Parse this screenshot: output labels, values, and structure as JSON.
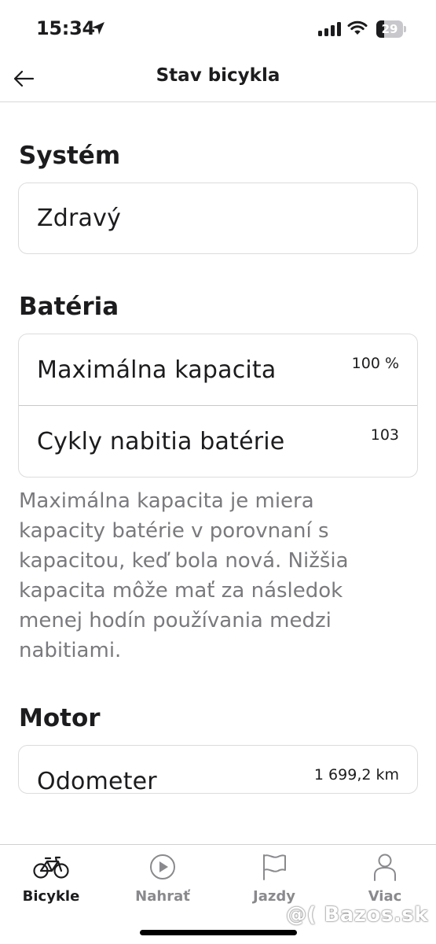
{
  "status_bar": {
    "time": "15:34",
    "battery_level": "29",
    "battery_fraction": 0.29
  },
  "header": {
    "title": "Stav bicykla"
  },
  "system": {
    "title": "Systém",
    "status": "Zdravý"
  },
  "battery": {
    "title": "Batéria",
    "rows": [
      {
        "label": "Maximálna kapacita",
        "value": "100 %"
      },
      {
        "label": "Cykly nabitia batérie",
        "value": "103"
      }
    ],
    "note": "Maximálna kapacita je miera kapacity batérie v porovnaní s kapacitou, keď bola nová. Nižšia kapacita môže mať za následok menej hodín používania medzi nabitiami."
  },
  "motor": {
    "title": "Motor",
    "rows": [
      {
        "label": "Odometer",
        "value": "1 699,2 km"
      }
    ]
  },
  "tab_bar": {
    "tabs": [
      {
        "label": "Bicykle",
        "icon": "bicycle-icon",
        "active": true
      },
      {
        "label": "Nahrať",
        "icon": "play-icon",
        "active": false
      },
      {
        "label": "Jazdy",
        "icon": "flag-icon",
        "active": false
      },
      {
        "label": "Viac",
        "icon": "person-icon",
        "active": false
      }
    ]
  },
  "watermark": "@( Bazos.sk"
}
